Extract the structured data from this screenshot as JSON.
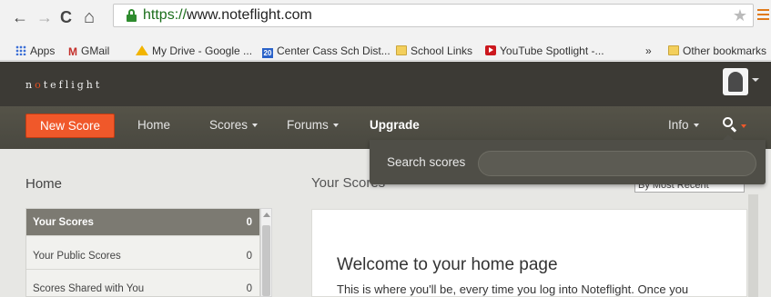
{
  "browser": {
    "url_scheme": "https://",
    "url_rest": "www.noteflight.com",
    "back_icon": "←",
    "forward_icon": "→",
    "reload_icon": "C",
    "home_icon": "⌂",
    "star_icon": "★",
    "bookmarks": [
      {
        "label": "Apps",
        "icon": "apps-icon"
      },
      {
        "label": "GMail",
        "icon": "gmail-icon"
      },
      {
        "label": "My Drive - Google ...",
        "icon": "drive-icon"
      },
      {
        "label": "Center Cass Sch Dist...",
        "icon": "calendar-icon",
        "icon_text": "20"
      },
      {
        "label": "School Links",
        "icon": "folder-icon"
      },
      {
        "label": "YouTube Spotlight -...",
        "icon": "youtube-icon"
      }
    ],
    "overflow_label": "»",
    "other_bookmarks": "Other bookmarks"
  },
  "app": {
    "logo_pre": "n",
    "logo_o": "o",
    "logo_post": "teflight"
  },
  "nav": {
    "new_score": "New Score",
    "home": "Home",
    "scores": "Scores",
    "forums": "Forums",
    "upgrade": "Upgrade",
    "info": "Info"
  },
  "search": {
    "label": "Search scores",
    "value": "",
    "placeholder": ""
  },
  "sidebar": {
    "title": "Home",
    "items": [
      {
        "label": "Your Scores",
        "count": "0",
        "active": true
      },
      {
        "label": "Your Public Scores",
        "count": "0",
        "active": false
      },
      {
        "label": "Scores Shared with You",
        "count": "0",
        "active": false
      }
    ]
  },
  "main": {
    "title": "Your Scores",
    "sort_value": "By Most Recent",
    "welcome_title": "Welcome to your home page",
    "welcome_text": "This is where you'll be, every time you log into Noteflight. Once you"
  },
  "colors": {
    "accent": "#f0582a",
    "header_bg": "#3c3a35",
    "nav_bg": "#494840",
    "sidebar_active": "#7c7a72"
  }
}
